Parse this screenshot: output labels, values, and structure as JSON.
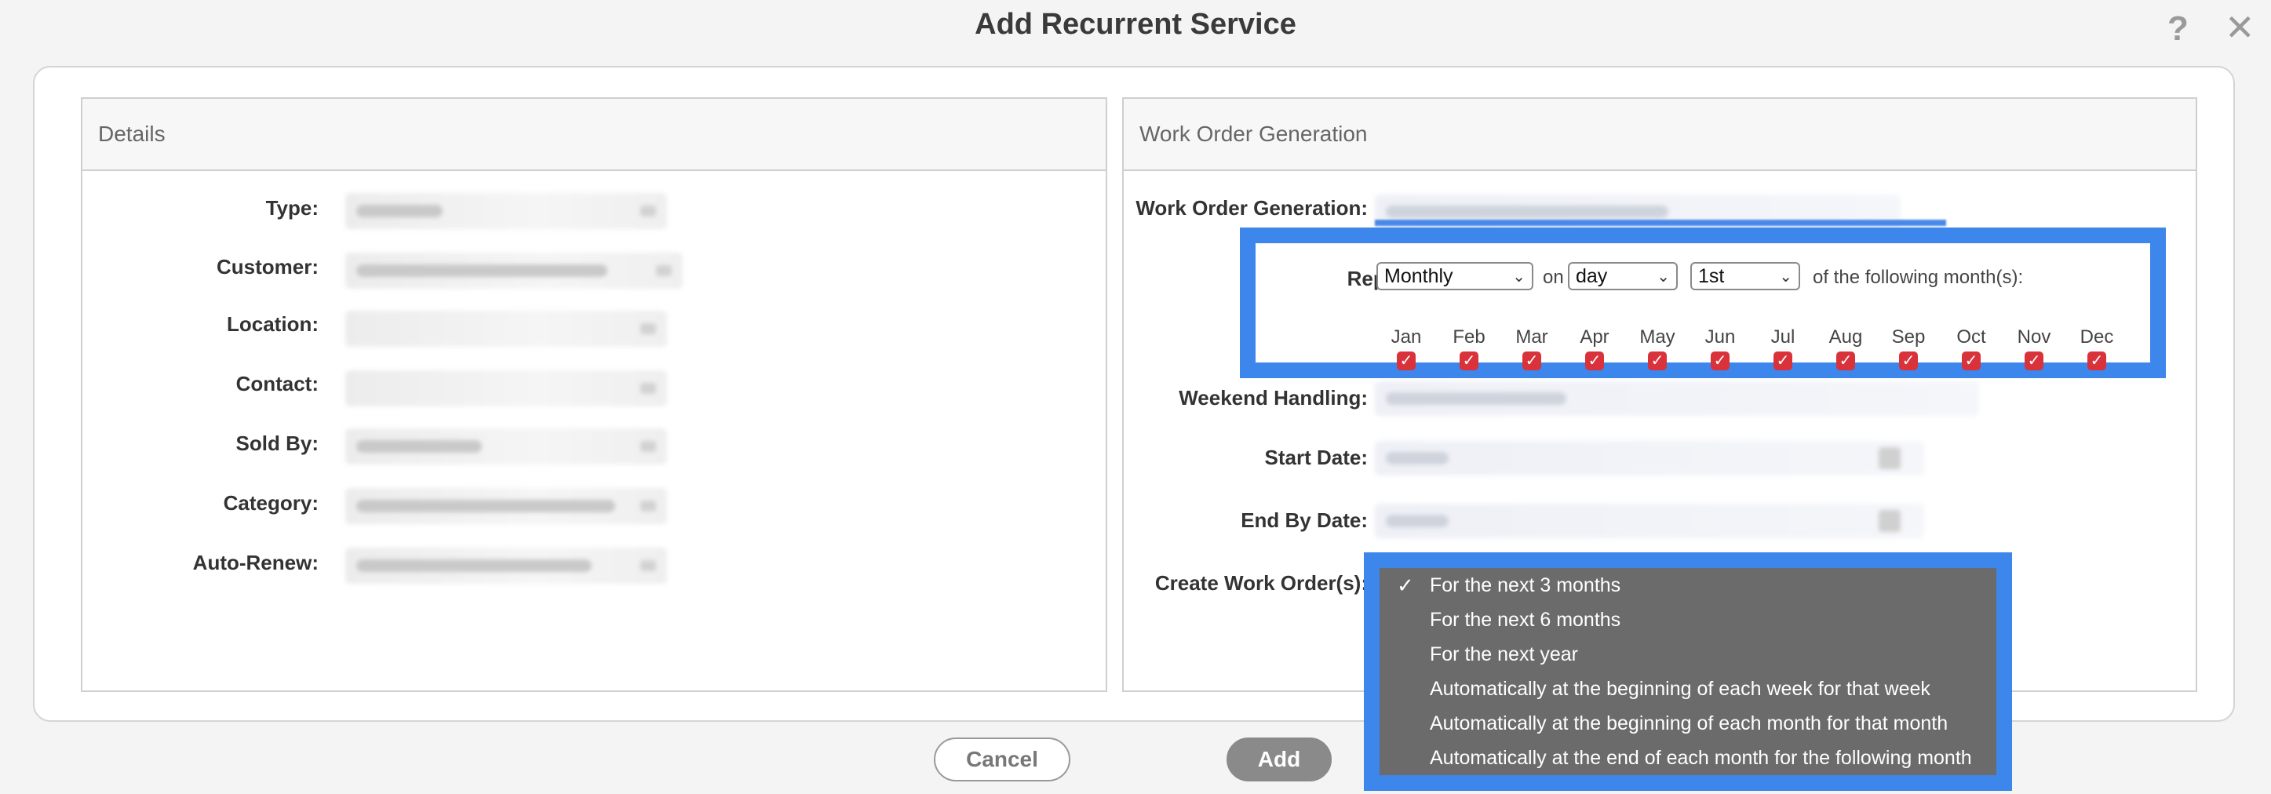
{
  "dialog": {
    "title": "Add Recurrent Service"
  },
  "header_icons": {
    "help": "?",
    "close": "✕"
  },
  "details": {
    "heading": "Details",
    "fields": [
      {
        "label": "Type:"
      },
      {
        "label": "Customer:"
      },
      {
        "label": "Location:"
      },
      {
        "label": "Contact:"
      },
      {
        "label": "Sold By:"
      },
      {
        "label": "Category:"
      },
      {
        "label": "Auto-Renew:"
      }
    ]
  },
  "work_order": {
    "heading": "Work Order Generation",
    "labels": {
      "generation": "Work Order Generation:",
      "repeat": "Repeat:",
      "weekend": "Weekend Handling:",
      "start": "Start Date:",
      "end": "End By Date:",
      "create": "Create Work Order(s):"
    },
    "repeat": {
      "frequency": "Monthly",
      "on_text": "on",
      "unit": "day",
      "day": "1st",
      "suffix": "of the following month(s):"
    },
    "months": [
      "Jan",
      "Feb",
      "Mar",
      "Apr",
      "May",
      "Jun",
      "Jul",
      "Aug",
      "Sep",
      "Oct",
      "Nov",
      "Dec"
    ],
    "months_checked": [
      true,
      true,
      true,
      true,
      true,
      true,
      true,
      true,
      true,
      true,
      true,
      true
    ]
  },
  "create_dropdown": {
    "selected_index": 0,
    "options": [
      "For the next 3 months",
      "For the next 6 months",
      "For the next year",
      "Automatically at the beginning of each week for that week",
      "Automatically at the beginning of each month for that month",
      "Automatically at the end of each month for the following month"
    ]
  },
  "buttons": {
    "cancel": "Cancel",
    "add": "Add"
  },
  "colors": {
    "highlight": "#3d86ec",
    "checkbox": "#d9323b",
    "dropdown_bg": "#6b6b6b"
  }
}
